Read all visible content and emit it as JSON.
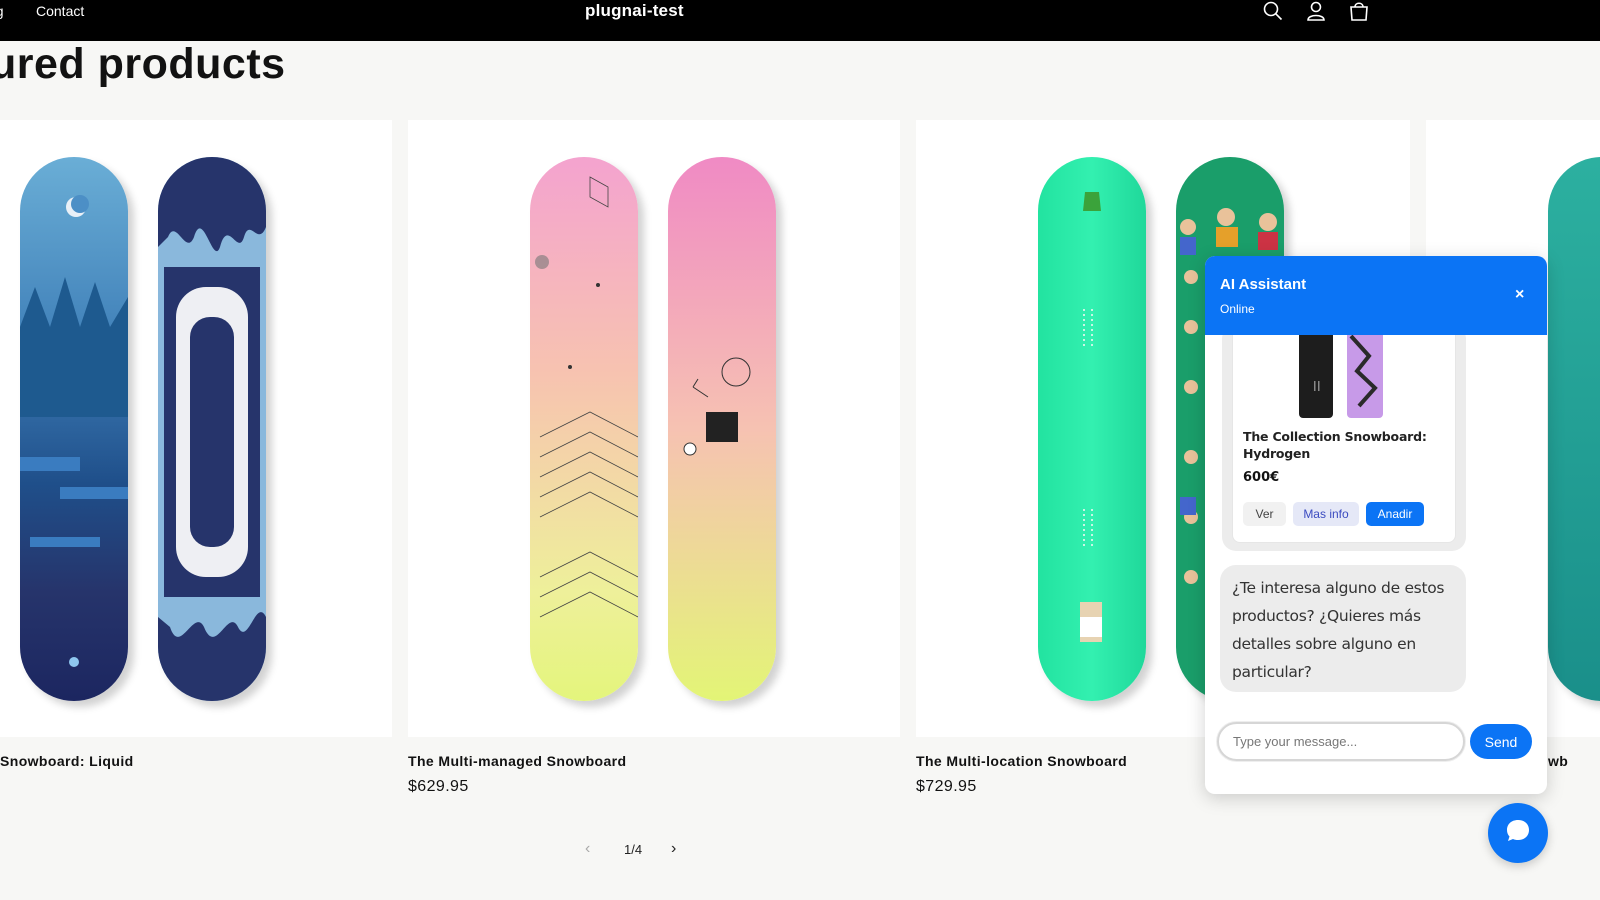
{
  "header": {
    "nav": {
      "blog": "og",
      "contact": "Contact"
    },
    "store_name": "plugnai-test",
    "icons": [
      "search-icon",
      "account-icon",
      "cart-icon"
    ]
  },
  "section": {
    "title": "ured products"
  },
  "products": [
    {
      "name": "Snowboard: Liquid",
      "price": ""
    },
    {
      "name": "The Multi-managed Snowboard",
      "price": "$629.95"
    },
    {
      "name": "The Multi-location Snowboard",
      "price": "$729.95"
    },
    {
      "name": "wb",
      "price": ""
    }
  ],
  "pagination": {
    "prev": "‹",
    "count": "1/4",
    "next": "›"
  },
  "chat": {
    "title": "AI Assistant",
    "status": "Online",
    "close": "×",
    "product": {
      "name": "The Collection Snowboard: Hydrogen",
      "price": "600€",
      "btn_view": "Ver",
      "btn_info": "Mas info",
      "btn_add": "Anadir"
    },
    "message": "¿Te interesa alguno de estos productos? ¿Quieres más detalles sobre alguno en particular?",
    "input_placeholder": "Type your message...",
    "send": "Send"
  },
  "colors": {
    "accent": "#0b74f5",
    "header_bg": "#000000",
    "page_bg": "#f7f7f5"
  }
}
